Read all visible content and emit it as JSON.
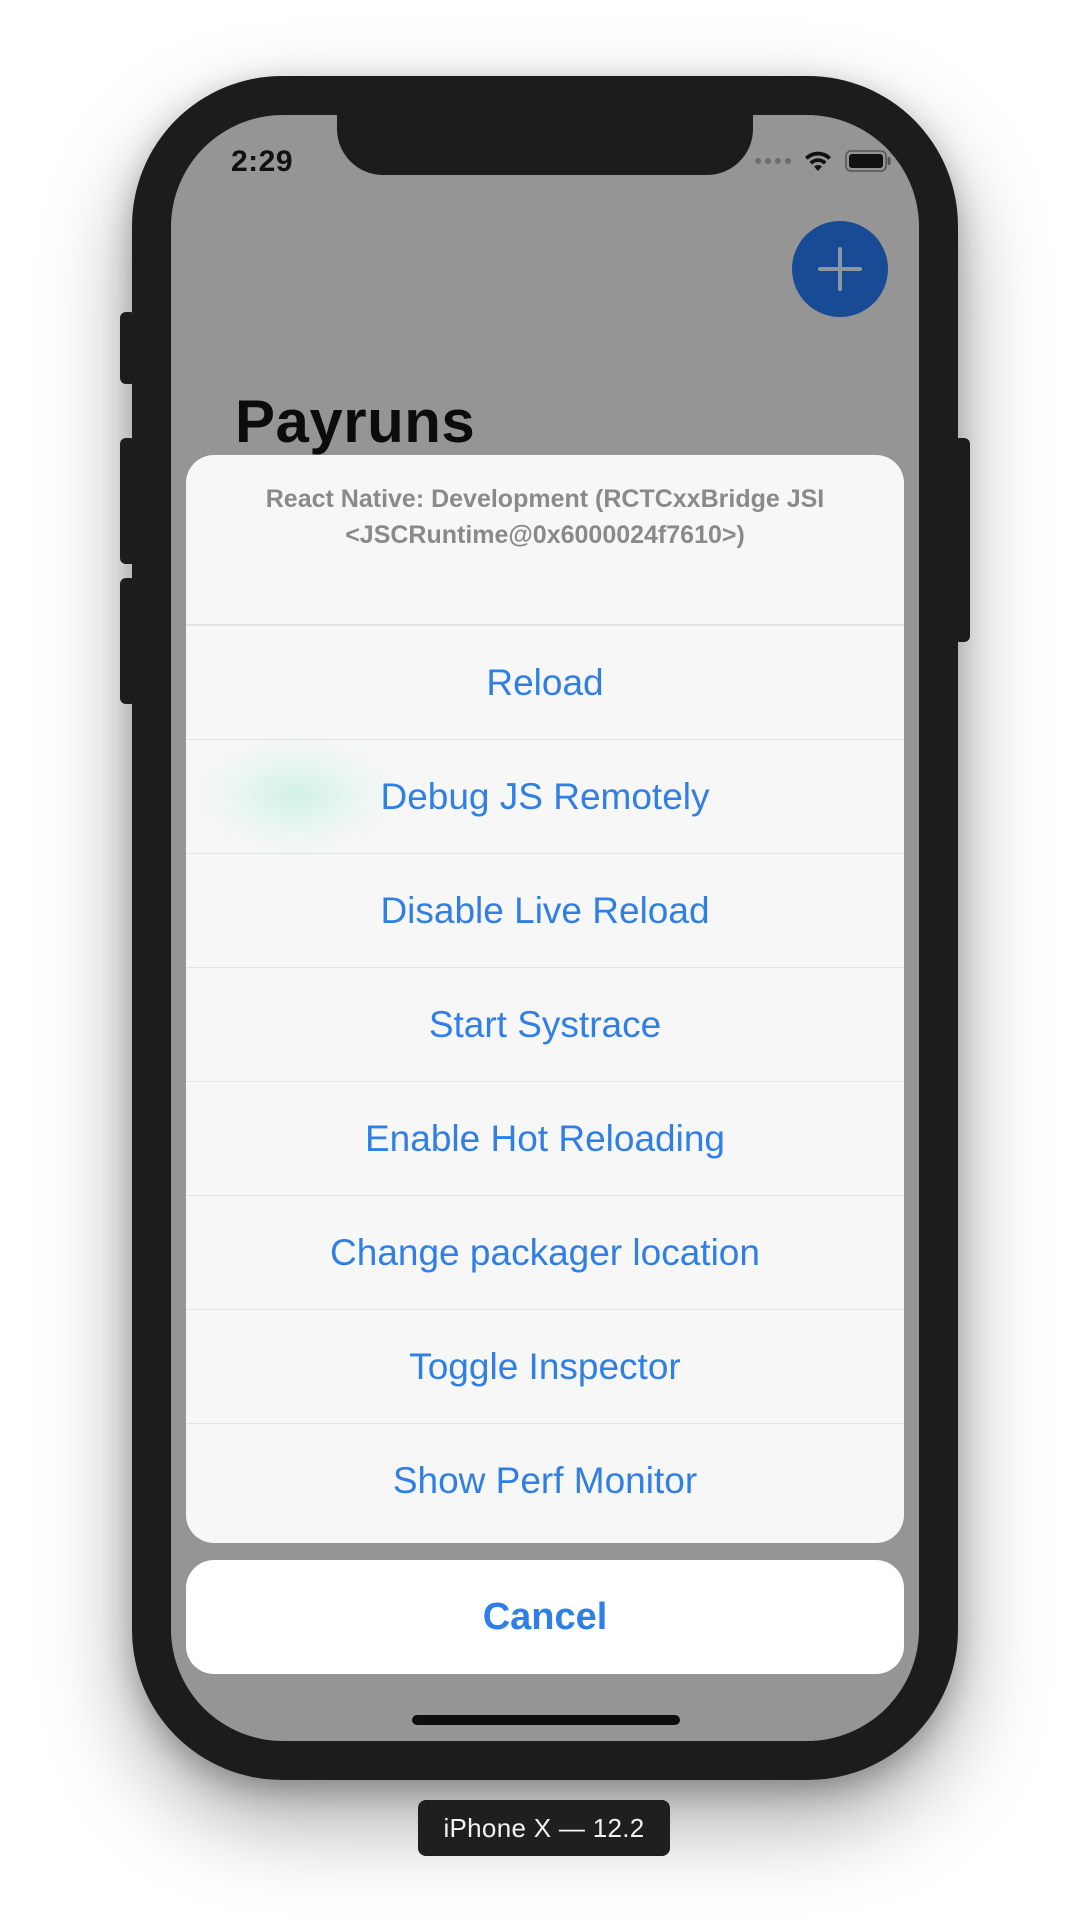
{
  "status_bar": {
    "time": "2:29"
  },
  "app": {
    "title": "Payruns",
    "fab_icon": "plus-icon",
    "fab_color": "#184a96"
  },
  "dev_menu": {
    "message": "React Native: Development (RCTCxxBridge JSI <JSCRuntime@0x6000024f7610>)",
    "options": [
      {
        "label": "Reload"
      },
      {
        "label": "Debug JS Remotely"
      },
      {
        "label": "Disable Live Reload"
      },
      {
        "label": "Start Systrace"
      },
      {
        "label": "Enable Hot Reloading"
      },
      {
        "label": "Change packager location"
      },
      {
        "label": "Toggle Inspector"
      },
      {
        "label": "Show Perf Monitor"
      }
    ],
    "cancel_label": "Cancel",
    "accent_color": "#2f7fe6"
  },
  "device": {
    "label": "iPhone X — 12.2"
  }
}
